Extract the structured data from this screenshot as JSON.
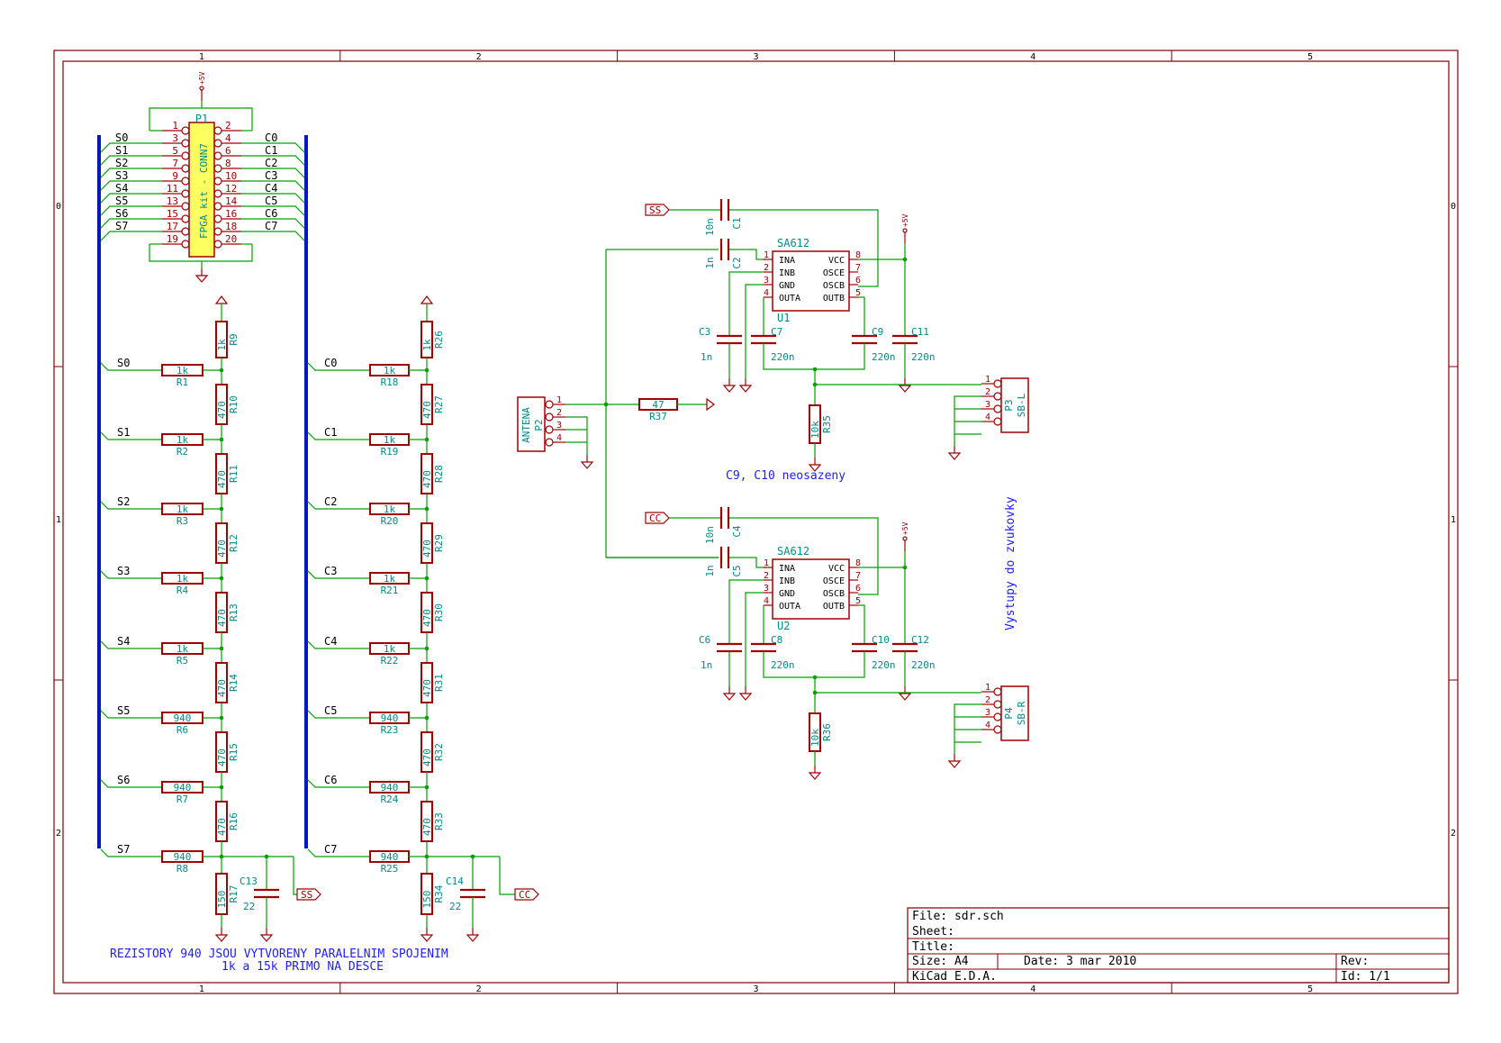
{
  "colors": {
    "border": "#7a0000",
    "wire": "#00a000",
    "bus": "#0018c0",
    "text": "#000000",
    "comp": "#a00000",
    "ref": "#008a8a",
    "ic_body": "#ffff60",
    "note": "#2020ff"
  },
  "frame": {
    "cols": [
      "1",
      "2",
      "3",
      "4",
      "5"
    ],
    "rows": [
      "0",
      "1",
      "2"
    ]
  },
  "connector_p1": {
    "ref": "P1",
    "value": "FPGA kit - CONN7",
    "pins_left": [
      "1",
      "3",
      "5",
      "7",
      "9",
      "11",
      "13",
      "15",
      "17",
      "19"
    ],
    "pins_right": [
      "2",
      "4",
      "6",
      "8",
      "10",
      "12",
      "14",
      "16",
      "18",
      "20"
    ],
    "nets_left": [
      "S0",
      "S1",
      "S2",
      "S3",
      "S4",
      "S5",
      "S6",
      "S7"
    ],
    "nets_right": [
      "C0",
      "C1",
      "C2",
      "C3",
      "C4",
      "C5",
      "C6",
      "C7"
    ],
    "power": "+5V"
  },
  "ladder_s": {
    "top_ref": "R9",
    "top_val": "1k",
    "taps": [
      {
        "net": "S0",
        "r_ref": "R1",
        "r_val": "1k",
        "v_ref": "R10",
        "v_val": "470"
      },
      {
        "net": "S1",
        "r_ref": "R2",
        "r_val": "1k",
        "v_ref": "R11",
        "v_val": "470"
      },
      {
        "net": "S2",
        "r_ref": "R3",
        "r_val": "1k",
        "v_ref": "R12",
        "v_val": "470"
      },
      {
        "net": "S3",
        "r_ref": "R4",
        "r_val": "1k",
        "v_ref": "R13",
        "v_val": "470"
      },
      {
        "net": "S4",
        "r_ref": "R5",
        "r_val": "1k",
        "v_ref": "R14",
        "v_val": "470"
      },
      {
        "net": "S5",
        "r_ref": "R6",
        "r_val": "940",
        "v_ref": "R15",
        "v_val": "470"
      },
      {
        "net": "S6",
        "r_ref": "R7",
        "r_val": "940",
        "v_ref": "R16",
        "v_val": "470"
      },
      {
        "net": "S7",
        "r_ref": "R8",
        "r_val": "940",
        "v_ref": "",
        "v_val": ""
      }
    ],
    "bottom_ref": "R17",
    "bottom_val": "150",
    "cap_ref": "C13",
    "cap_val": "22",
    "label": "SS"
  },
  "ladder_c": {
    "top_ref": "R26",
    "top_val": "1k",
    "taps": [
      {
        "net": "C0",
        "r_ref": "R18",
        "r_val": "1k",
        "v_ref": "R27",
        "v_val": "470"
      },
      {
        "net": "C1",
        "r_ref": "R19",
        "r_val": "1k",
        "v_ref": "R28",
        "v_val": "470"
      },
      {
        "net": "C2",
        "r_ref": "R20",
        "r_val": "1k",
        "v_ref": "R29",
        "v_val": "470"
      },
      {
        "net": "C3",
        "r_ref": "R21",
        "r_val": "1k",
        "v_ref": "R30",
        "v_val": "470"
      },
      {
        "net": "C4",
        "r_ref": "R22",
        "r_val": "1k",
        "v_ref": "R31",
        "v_val": "470"
      },
      {
        "net": "C5",
        "r_ref": "R23",
        "r_val": "940",
        "v_ref": "R32",
        "v_val": "470"
      },
      {
        "net": "C6",
        "r_ref": "R24",
        "r_val": "940",
        "v_ref": "R33",
        "v_val": "470"
      },
      {
        "net": "C7",
        "r_ref": "R25",
        "r_val": "940",
        "v_ref": "",
        "v_val": ""
      }
    ],
    "bottom_ref": "R34",
    "bottom_val": "150",
    "cap_ref": "C14",
    "cap_val": "22",
    "label": "CC"
  },
  "mixer_1": {
    "ic_ref": "U1",
    "ic_val": "SA612",
    "in_label": "SS",
    "pins_left": [
      {
        "n": "1",
        "name": "INA"
      },
      {
        "n": "2",
        "name": "INB"
      },
      {
        "n": "3",
        "name": "GND"
      },
      {
        "n": "4",
        "name": "OUTA"
      }
    ],
    "pins_right": [
      {
        "n": "8",
        "name": "VCC"
      },
      {
        "n": "7",
        "name": "OSCE"
      },
      {
        "n": "6",
        "name": "OSCB"
      },
      {
        "n": "5",
        "name": "OUTB"
      }
    ],
    "c_a_ref": "C1",
    "c_a_val": "10n",
    "c_b_ref": "C2",
    "c_b_val": "1n",
    "c_c_ref": "C3",
    "c_c_val": "1n",
    "c_d_ref": "C7",
    "c_d_val": "220n",
    "c_e_ref": "C9",
    "c_e_val": "220n",
    "c_f_ref": "C11",
    "c_f_val": "220n",
    "r_ref": "R35",
    "r_val": "10k",
    "power": "+5V",
    "out_ref": "P3",
    "out_val": "SB-L",
    "out_pins": [
      "1",
      "2",
      "3",
      "4"
    ]
  },
  "mixer_2": {
    "ic_ref": "U2",
    "ic_val": "SA612",
    "in_label": "CC",
    "pins_left": [
      {
        "n": "1",
        "name": "INA"
      },
      {
        "n": "2",
        "name": "INB"
      },
      {
        "n": "3",
        "name": "GND"
      },
      {
        "n": "4",
        "name": "OUTA"
      }
    ],
    "pins_right": [
      {
        "n": "8",
        "name": "VCC"
      },
      {
        "n": "7",
        "name": "OSCE"
      },
      {
        "n": "6",
        "name": "OSCB"
      },
      {
        "n": "5",
        "name": "OUTB"
      }
    ],
    "c_a_ref": "C4",
    "c_a_val": "10n",
    "c_b_ref": "C5",
    "c_b_val": "1n",
    "c_c_ref": "C6",
    "c_c_val": "1n",
    "c_d_ref": "C8",
    "c_d_val": "220n",
    "c_e_ref": "C10",
    "c_e_val": "220n",
    "c_f_ref": "C12",
    "c_f_val": "220n",
    "r_ref": "R36",
    "r_val": "10k",
    "power": "+5V",
    "out_ref": "P4",
    "out_val": "SB-R",
    "out_pins": [
      "1",
      "2",
      "3",
      "4"
    ]
  },
  "antenna": {
    "ref": "P2",
    "value": "ANTENA",
    "pins": [
      "1",
      "2",
      "3",
      "4"
    ],
    "r_ref": "R37",
    "r_val": "47"
  },
  "notes": {
    "caps_unpopulated": "C9, C10 neosazeny",
    "outputs": "Vystupy do zvukovky",
    "resistors_line1": "REZISTORY 940 JSOU VYTVORENY PARALELNIM SPOJENIM",
    "resistors_line2": "1k a 15k PRIMO NA DESCE"
  },
  "title_block": {
    "file": "File: sdr.sch",
    "sheet": "Sheet:",
    "title": "Title:",
    "size": "Size: A4",
    "date": "Date: 3 mar 2010",
    "rev": "Rev:",
    "tool": "KiCad E.D.A.",
    "id": "Id: 1/1"
  }
}
